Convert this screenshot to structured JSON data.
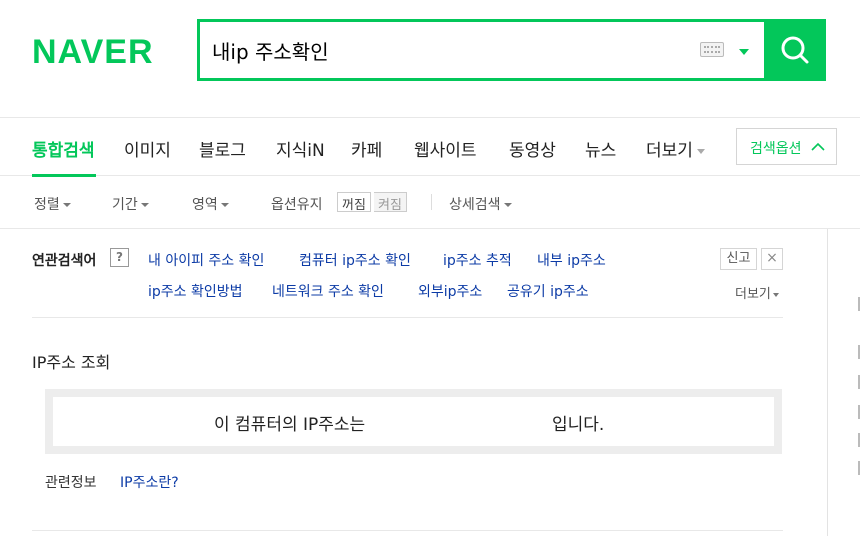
{
  "logo": "NAVER",
  "search": {
    "query": "내ip 주소확인"
  },
  "tabs": [
    {
      "label": "통합검색",
      "active": true
    },
    {
      "label": "이미지"
    },
    {
      "label": "블로그"
    },
    {
      "label": "지식iN"
    },
    {
      "label": "카페"
    },
    {
      "label": "웹사이트"
    },
    {
      "label": "동영상"
    },
    {
      "label": "뉴스"
    },
    {
      "label": "더보기"
    }
  ],
  "search_options_label": "검색옵션",
  "filters": {
    "sort": "정렬",
    "period": "기간",
    "area": "영역",
    "keep_option": "옵션유지",
    "off": "꺼짐",
    "on": "켜짐",
    "detail": "상세검색"
  },
  "related": {
    "label": "연관검색어",
    "help": "?",
    "row1": [
      "내 아이피 주소 확인",
      "컴퓨터 ip주소 확인",
      "ip주소 추적",
      "내부 ip주소"
    ],
    "row2": [
      "ip주소 확인방법",
      "네트워크 주소 확인",
      "외부ip주소",
      "공유기 ip주소"
    ],
    "report": "신고",
    "close": "×",
    "more": "더보기"
  },
  "ip_lookup": {
    "title": "IP주소 조회",
    "prefix": "이 컴퓨터의 IP주소는",
    "suffix": "입니다.",
    "info_label": "관련정보",
    "info_link": "IP주소란?"
  },
  "colors": {
    "brand": "#03c75a",
    "link": "#0c3ba6"
  }
}
